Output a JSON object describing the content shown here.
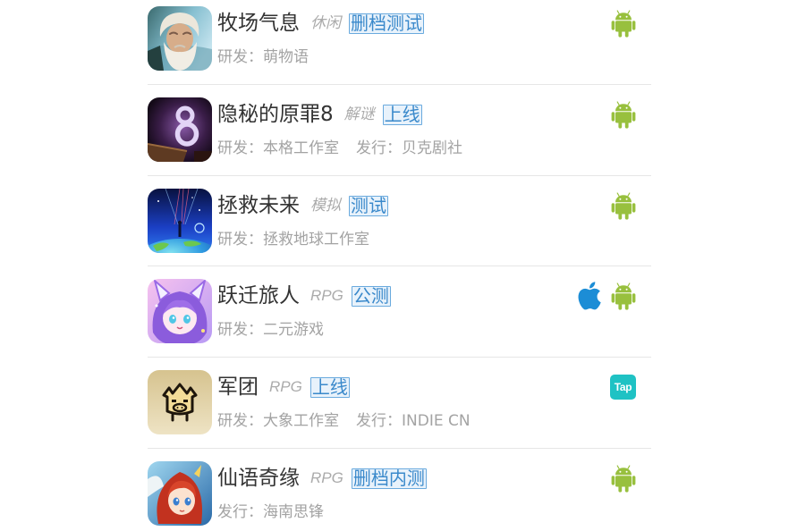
{
  "games": [
    {
      "title": "牧场气息",
      "genre": "休闲",
      "status": "删档测试",
      "credits": [
        "研发：萌物语"
      ],
      "platforms": [
        "android-icon"
      ]
    },
    {
      "title": "隐秘的原罪8",
      "genre": "解谜",
      "status": "上线",
      "credits": [
        "研发：本格工作室",
        "发行：贝克剧社"
      ],
      "platforms": [
        "android-icon"
      ]
    },
    {
      "title": "拯救未来",
      "genre": "模拟",
      "status": "测试",
      "credits": [
        "研发：拯救地球工作室"
      ],
      "platforms": [
        "android-icon"
      ]
    },
    {
      "title": "跃迁旅人",
      "genre": "RPG",
      "status": "公测",
      "credits": [
        "研发：二元游戏"
      ],
      "platforms": [
        "apple-icon",
        "android-icon"
      ]
    },
    {
      "title": "军团",
      "genre": "RPG",
      "status": "上线",
      "credits": [
        "研发：大象工作室",
        "发行：INDIE CN"
      ],
      "platforms": [
        "taptap-icon"
      ]
    },
    {
      "title": "仙语奇缘",
      "genre": "RPG",
      "status": "删档内测",
      "credits": [
        "发行：海南思锋"
      ],
      "platforms": [
        "android-icon"
      ]
    }
  ],
  "logos": {
    "tap": "Tap"
  },
  "colors": {
    "title": "#333333",
    "genre": "#ababab",
    "credit": "#a3a3a3",
    "badge_text": "#3a89cb",
    "badge_border": "#6aaade",
    "badge_bg": "#e8f2fb",
    "android": "#98c03e",
    "apple": "#1c8dd6",
    "tap": "#1fc2c4",
    "divider": "#e6e6e6",
    "background": "#ffffff"
  }
}
